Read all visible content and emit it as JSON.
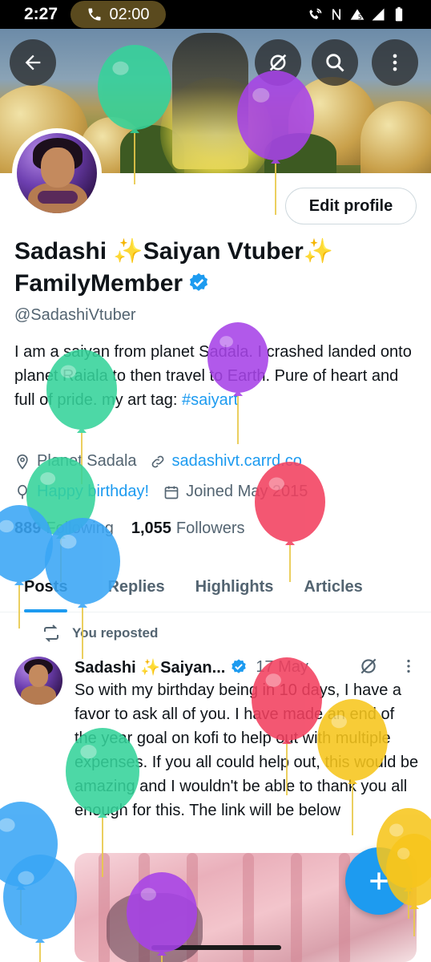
{
  "status_bar": {
    "time": "2:27",
    "call_duration": "02:00"
  },
  "profile": {
    "display_name": "Sadashi ✨Saiyan Vtuber✨ FamilyMember",
    "handle": "@SadashiVtuber",
    "edit_profile_label": "Edit profile",
    "bio_text": "I am a saiyan from planet Sadala. I crashed landed onto planet Raiala to then travel to Earth. Pure of heart and full of pride.  my art tag: ",
    "bio_hashtag": "#saiyart",
    "location": "Planet Sadala",
    "website": "sadashivt.carrd.co",
    "birthday": "Happy birthday!",
    "joined": "Joined May 2015",
    "following_count": "889",
    "following_label": "Following",
    "followers_count": "1,055",
    "followers_label": "Followers"
  },
  "tabs": [
    {
      "label": "Posts",
      "active": true
    },
    {
      "label": "Replies",
      "active": false
    },
    {
      "label": "Highlights",
      "active": false
    },
    {
      "label": "Articles",
      "active": false
    }
  ],
  "post": {
    "repost_label": "You reposted",
    "author_name": "Sadashi ✨Saiyan...",
    "date": "17 May",
    "text": "So with my birthday being in 10 days, I have a favor to ask all of you. I have made an end of the year goal on kofi to help out with multiple expenses. If you all could help out, this would be amazing and I wouldn't be able to thank you all enough for this. The link will be below"
  },
  "colors": {
    "accent": "#1d9bf0",
    "balloon_green": "#35d39a",
    "balloon_purple": "#a743e8",
    "balloon_red": "#f2405f",
    "balloon_blue": "#3aa6f5",
    "balloon_yellow": "#f7c61c"
  },
  "icons": {
    "back": "arrow-left-icon",
    "grok": "grok-icon",
    "search": "search-icon",
    "more": "more-vertical-icon",
    "location": "location-pin-icon",
    "link": "link-icon",
    "birthday": "balloon-icon",
    "calendar": "calendar-icon",
    "repost": "repost-icon",
    "verified": "verified-badge-icon",
    "compose": "plus-icon"
  }
}
